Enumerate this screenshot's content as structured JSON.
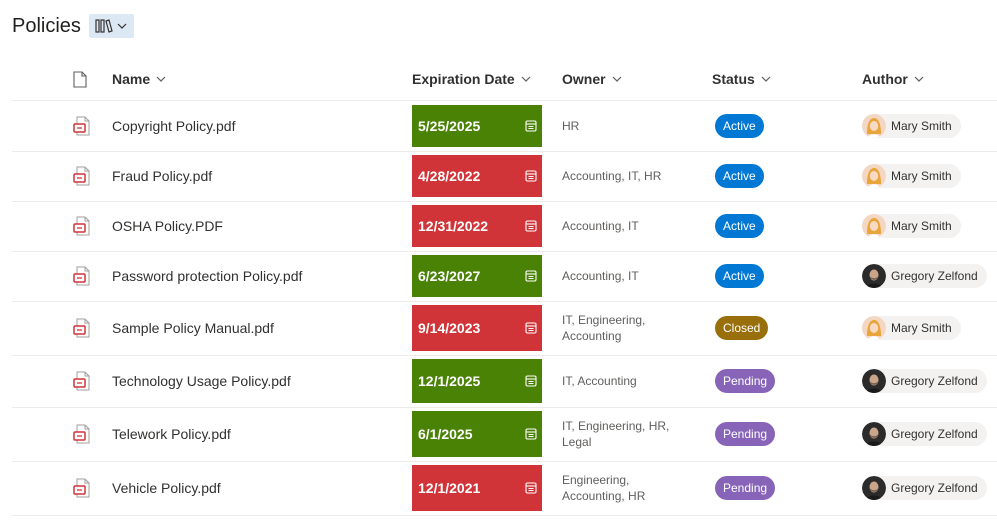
{
  "header": {
    "title": "Policies"
  },
  "columns": {
    "name": "Name",
    "expiration": "Expiration Date",
    "owner": "Owner",
    "status": "Status",
    "author": "Author"
  },
  "colors": {
    "green": "#498205",
    "red": "#d13438",
    "active": "#0078d4",
    "closed": "#986f0b",
    "pending": "#8764b8",
    "pdf_icon": "#d13438"
  },
  "rows": [
    {
      "name": "Copyright Policy.pdf",
      "date": "5/25/2025",
      "date_state": "green",
      "owner": "HR",
      "status": "Active",
      "status_color": "active",
      "author": "Mary Smith",
      "avatar": "mary"
    },
    {
      "name": "Fraud Policy.pdf",
      "date": "4/28/2022",
      "date_state": "red",
      "owner": "Accounting, IT, HR",
      "status": "Active",
      "status_color": "active",
      "author": "Mary Smith",
      "avatar": "mary"
    },
    {
      "name": "OSHA Policy.PDF",
      "date": "12/31/2022",
      "date_state": "red",
      "owner": "Accounting, IT",
      "status": "Active",
      "status_color": "active",
      "author": "Mary Smith",
      "avatar": "mary"
    },
    {
      "name": "Password protection Policy.pdf",
      "date": "6/23/2027",
      "date_state": "green",
      "owner": "Accounting, IT",
      "status": "Active",
      "status_color": "active",
      "author": "Gregory Zelfond",
      "avatar": "gregory"
    },
    {
      "name": "Sample Policy Manual.pdf",
      "date": "9/14/2023",
      "date_state": "red",
      "owner": "IT, Engineering, Accounting",
      "status": "Closed",
      "status_color": "closed",
      "author": "Mary Smith",
      "avatar": "mary"
    },
    {
      "name": "Technology Usage Policy.pdf",
      "date": "12/1/2025",
      "date_state": "green",
      "owner": "IT, Accounting",
      "status": "Pending",
      "status_color": "pending",
      "author": "Gregory Zelfond",
      "avatar": "gregory"
    },
    {
      "name": "Telework Policy.pdf",
      "date": "6/1/2025",
      "date_state": "green",
      "owner": "IT, Engineering, HR, Legal",
      "status": "Pending",
      "status_color": "pending",
      "author": "Gregory Zelfond",
      "avatar": "gregory"
    },
    {
      "name": "Vehicle Policy.pdf",
      "date": "12/1/2021",
      "date_state": "red",
      "owner": "Engineering, Accounting, HR",
      "status": "Pending",
      "status_color": "pending",
      "author": "Gregory Zelfond",
      "avatar": "gregory"
    }
  ]
}
